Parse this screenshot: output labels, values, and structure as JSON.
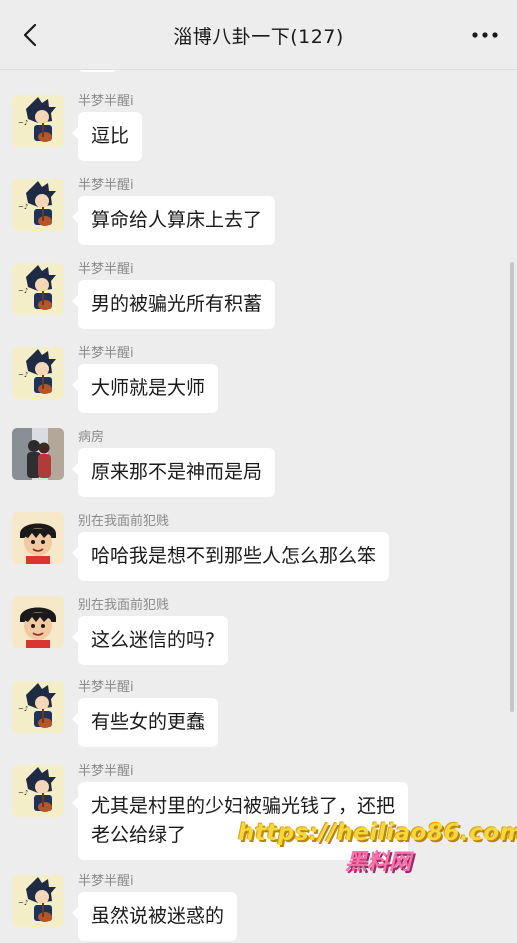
{
  "header": {
    "title": "淄博八卦一下(127)",
    "back_icon": "chevron-left-icon",
    "more_icon": "more-dots-icon"
  },
  "messages": [
    {
      "sender": "半梦半醒i",
      "avatar": "anime-guitar-avatar",
      "text": "逗比"
    },
    {
      "sender": "半梦半醒i",
      "avatar": "anime-guitar-avatar",
      "text": "算命给人算床上去了"
    },
    {
      "sender": "半梦半醒i",
      "avatar": "anime-guitar-avatar",
      "text": "男的被骗光所有积蓄"
    },
    {
      "sender": "半梦半醒i",
      "avatar": "anime-guitar-avatar",
      "text": "大师就是大师"
    },
    {
      "sender": "病房",
      "avatar": "couple-photo-avatar",
      "text": "原来那不是神而是局"
    },
    {
      "sender": "别在我面前犯贱",
      "avatar": "luffy-avatar",
      "text": "哈哈我是想不到那些人怎么那么笨"
    },
    {
      "sender": "别在我面前犯贱",
      "avatar": "luffy-avatar",
      "text": "这么迷信的吗?"
    },
    {
      "sender": "半梦半醒i",
      "avatar": "anime-guitar-avatar",
      "text": "有些女的更蠢"
    },
    {
      "sender": "半梦半醒i",
      "avatar": "anime-guitar-avatar",
      "text": "尤其是村里的少妇被骗光钱了，还把\n老公给绿了"
    },
    {
      "sender": "半梦半醒i",
      "avatar": "anime-guitar-avatar",
      "text": "虽然说被迷惑的"
    }
  ],
  "watermark": {
    "url": "https://heiliao86.com",
    "name": "黑料网"
  }
}
